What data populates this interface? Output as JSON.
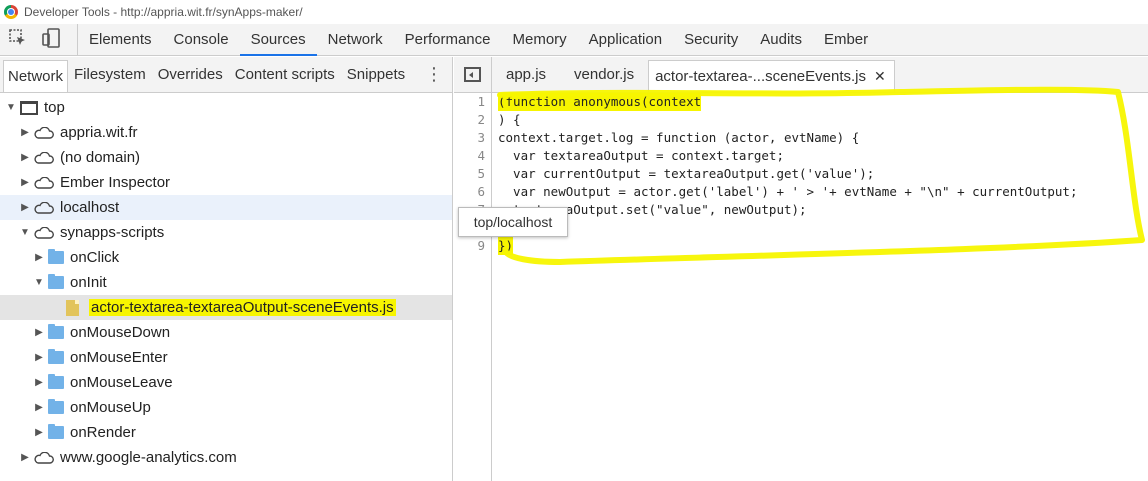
{
  "window": {
    "title": "Developer Tools - http://appria.wit.fr/synApps-maker/"
  },
  "toolbar": {
    "tabs": [
      "Elements",
      "Console",
      "Sources",
      "Network",
      "Performance",
      "Memory",
      "Application",
      "Security",
      "Audits",
      "Ember"
    ],
    "active_tab": "Sources"
  },
  "navigator": {
    "tabs": [
      "Network",
      "Filesystem",
      "Overrides",
      "Content scripts",
      "Snippets"
    ],
    "active_tab": "Network",
    "tree": {
      "top": "top",
      "origin_appria": "appria.wit.fr",
      "origin_nodomain": "(no domain)",
      "origin_ember": "Ember Inspector",
      "origin_localhost": "localhost",
      "origin_synapps": "synapps-scripts",
      "folder_onclick": "onClick",
      "folder_oninit": "onInit",
      "file_selected": "actor-textarea-textareaOutput-sceneEvents.js",
      "folder_onmousedown": "onMouseDown",
      "folder_onmouseenter": "onMouseEnter",
      "folder_onmouseleave": "onMouseLeave",
      "folder_onmouseup": "onMouseUp",
      "folder_onrender": "onRender",
      "origin_google": "www.google-analytics.com"
    }
  },
  "editor": {
    "tabs": [
      "app.js",
      "vendor.js",
      "actor-textarea-...sceneEvents.js"
    ],
    "active_tab": "actor-textarea-...sceneEvents.js",
    "line_numbers": [
      "1",
      "2",
      "3",
      "4",
      "5",
      "6",
      "7",
      "8",
      "9"
    ],
    "code_lines": {
      "l1": "(function anonymous(context",
      "l2": ") {",
      "l3": "context.target.log = function (actor, evtName) {",
      "l4": "  var textareaOutput = context.target;",
      "l5": "  var currentOutput = textareaOutput.get('value');",
      "l6": "  var newOutput = actor.get('label') + ' > '+ evtName + \"\\n\" + currentOutput;",
      "l7": "  textareaOutput.set(\"value\", newOutput);",
      "l8": "}",
      "l9": "})"
    }
  },
  "tooltip": {
    "text": "top/localhost"
  },
  "highlight_color": "#f7f500"
}
